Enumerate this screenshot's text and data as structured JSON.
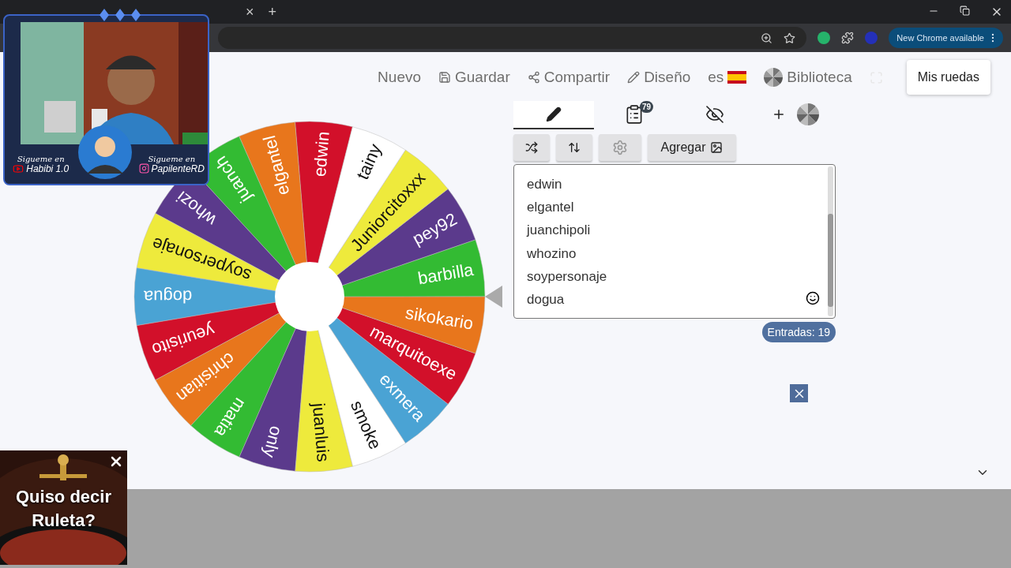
{
  "browser": {
    "tab_close": "×",
    "new_tab": "+",
    "update_button": "New Chrome available"
  },
  "webcam": {
    "channels": [
      {
        "kind": "youtube",
        "label": "Sigueme en",
        "handle": "Habibi 1.0"
      },
      {
        "kind": "instagram",
        "label": "Sigueme en",
        "handle": "PapilenteRD"
      }
    ]
  },
  "nav": {
    "items": [
      {
        "kind": "plain",
        "label": "Nuevo"
      },
      {
        "kind": "save",
        "label": "Guardar"
      },
      {
        "kind": "share",
        "label": "Compartir"
      },
      {
        "kind": "design",
        "label": "Diseño"
      },
      {
        "kind": "language",
        "label": "es"
      },
      {
        "kind": "library",
        "label": "Biblioteca"
      },
      {
        "kind": "fullscreen"
      }
    ],
    "my_wheels": "Mis ruedas"
  },
  "wheel": {
    "segments": [
      {
        "label": "edwin",
        "color": "#d2102a"
      },
      {
        "label": "elgantel",
        "color": "#e8761c"
      },
      {
        "label": "juanch",
        "color": "#33bb33"
      },
      {
        "label": "whozi",
        "color": "#5b3a8c"
      },
      {
        "label": "soypersonaje",
        "color": "#eeea3c"
      },
      {
        "label": "dogua",
        "color": "#4aa3d4"
      },
      {
        "label": "yeurisito",
        "color": "#d2102a"
      },
      {
        "label": "chrisitian",
        "color": "#e8761c"
      },
      {
        "label": "matia",
        "color": "#33bb33"
      },
      {
        "label": "only",
        "color": "#5b3a8c"
      },
      {
        "label": "juanluis",
        "color": "#eeea3c"
      },
      {
        "label": "smoke",
        "color": "#ffffff"
      },
      {
        "label": "exmera",
        "color": "#4aa3d4"
      },
      {
        "label": "marquitoexe",
        "color": "#d2102a"
      },
      {
        "label": "sikokario",
        "color": "#e8761c"
      },
      {
        "label": "barbilla",
        "color": "#33bb33"
      },
      {
        "label": "pey92",
        "color": "#5b3a8c"
      },
      {
        "label": "Juniorcitoxxx",
        "color": "#eeea3c"
      },
      {
        "label": "tainy",
        "color": "#ffffff"
      }
    ]
  },
  "editor": {
    "tabs": [
      {
        "kind": "edit",
        "selected": true
      },
      {
        "kind": "results",
        "badge": "79",
        "selected": false
      },
      {
        "kind": "hide",
        "selected": false
      },
      {
        "kind": "add",
        "selected": false
      }
    ],
    "tools": [
      {
        "kind": "shuffle",
        "disabled": false
      },
      {
        "kind": "sort",
        "disabled": false
      },
      {
        "kind": "settings",
        "disabled": true
      },
      {
        "kind": "add_image",
        "label": "Agregar",
        "disabled": false
      }
    ],
    "entries": [
      "edwin",
      "elgantel",
      "juanchipoli",
      "whozino",
      "soypersonaje",
      "dogua"
    ],
    "count": "Entradas: 19"
  },
  "ad": {
    "lines": [
      "Quiso decir",
      "Ruleta?"
    ]
  }
}
